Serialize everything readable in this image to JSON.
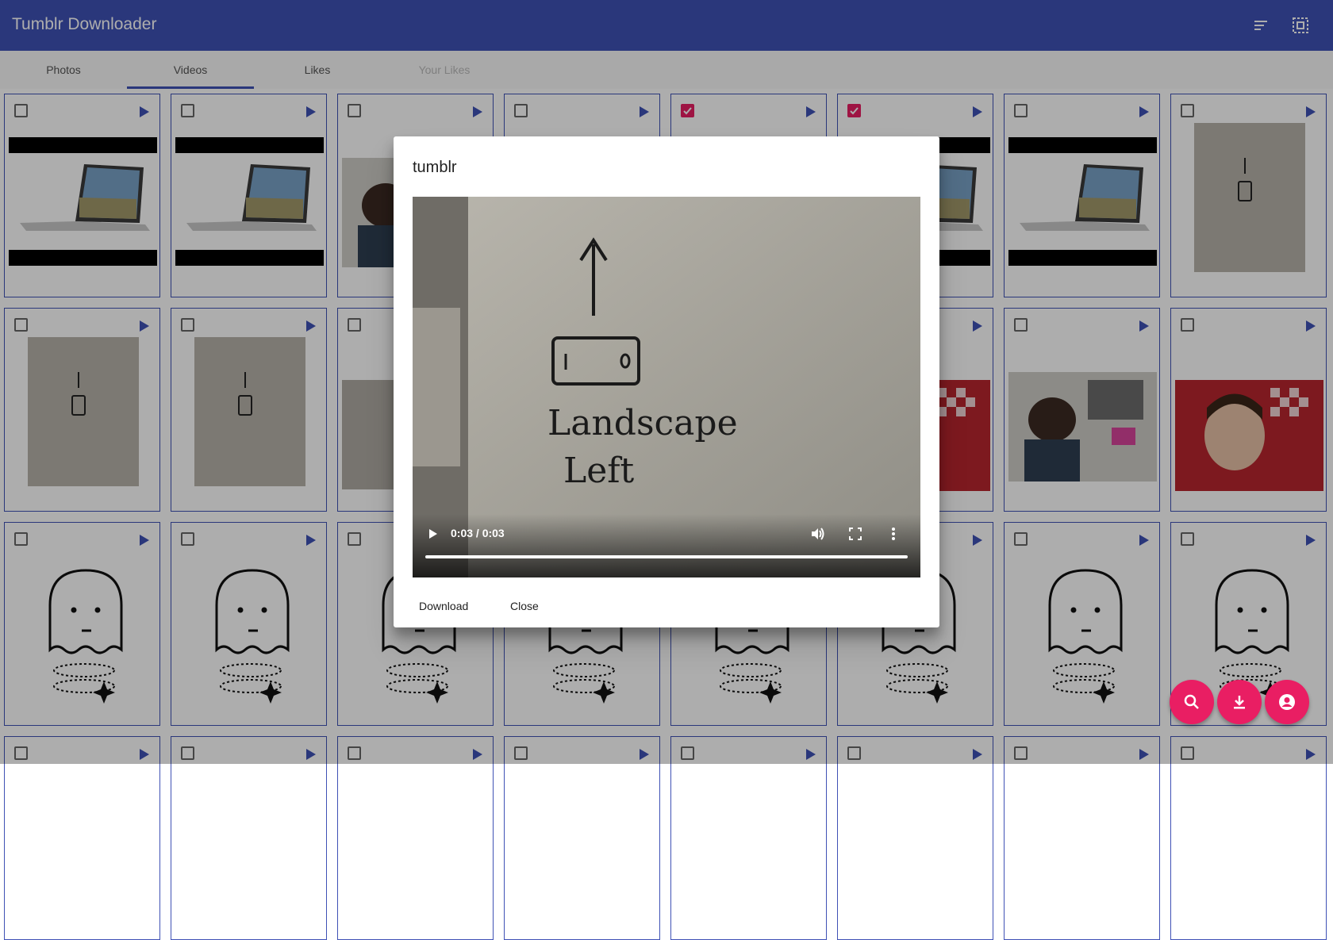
{
  "appbar": {
    "title": "Tumblr Downloader",
    "icons": [
      "sort-icon",
      "select-all-icon"
    ]
  },
  "tabs": [
    {
      "label": "Photos",
      "active": false,
      "disabled": false
    },
    {
      "label": "Videos",
      "active": true,
      "disabled": false
    },
    {
      "label": "Likes",
      "active": false,
      "disabled": false
    },
    {
      "label": "Your Likes",
      "active": false,
      "disabled": true
    }
  ],
  "grid": {
    "rows": [
      {
        "cells": [
          "laptop",
          "laptop",
          "person-desk",
          "hidden",
          "hidden",
          "laptop",
          "laptop",
          "paper-updown"
        ],
        "checked": [
          false,
          false,
          false,
          false,
          true,
          true,
          false,
          false
        ]
      },
      {
        "cells": [
          "paper-portrait",
          "paper-landscape-right",
          "paper-landscape-left",
          "hidden",
          "hidden",
          "plaid-person",
          "person-desk",
          "plaid-person"
        ],
        "checked": [
          false,
          false,
          false,
          false,
          false,
          false,
          false,
          false
        ]
      },
      {
        "cells": [
          "ghost",
          "ghost",
          "ghost",
          "ghost",
          "ghost",
          "ghost",
          "ghost",
          "ghost"
        ],
        "checked": [
          false,
          false,
          false,
          false,
          false,
          false,
          false,
          false
        ]
      },
      {
        "cells": [
          "blank",
          "blank",
          "blank",
          "blank",
          "blank",
          "blank",
          "blank",
          "blank"
        ],
        "checked": [
          false,
          false,
          false,
          false,
          false,
          false,
          false,
          false
        ]
      }
    ]
  },
  "dialog": {
    "title": "tumblr",
    "video": {
      "time": "0:03 / 0:03",
      "progress": 1.0,
      "note_line1": "Landscape",
      "note_line2": "Left"
    },
    "download_label": "Download",
    "close_label": "Close"
  },
  "fabs": [
    {
      "icon": "search-icon"
    },
    {
      "icon": "download-icon"
    },
    {
      "icon": "account-icon"
    }
  ],
  "colors": {
    "primary": "#3f51b5",
    "accent": "#e91e63"
  }
}
